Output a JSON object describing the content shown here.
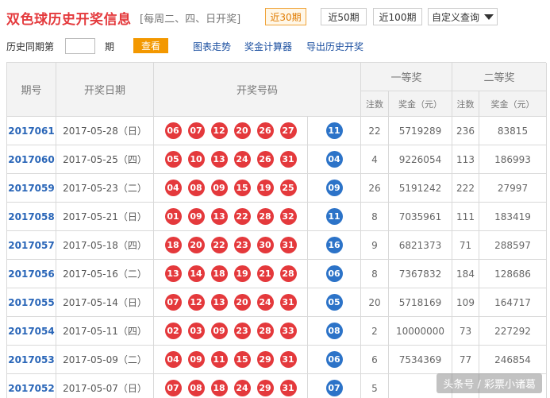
{
  "header": {
    "title": "双色球历史开奖信息",
    "subtitle": "[每周二、四、日开奖]",
    "tabs": [
      {
        "label": "近30期",
        "active": true
      },
      {
        "label": "近50期",
        "active": false
      },
      {
        "label": "近100期",
        "active": false
      }
    ],
    "custom_query": "自定义查询"
  },
  "toolbar": {
    "history_label": "历史同期第",
    "period_value": "",
    "period_unit": "期",
    "view_button": "查看",
    "links": [
      "图表走势",
      "奖金计算器",
      "导出历史开奖"
    ]
  },
  "table": {
    "headers": {
      "issue": "期号",
      "date": "开奖日期",
      "numbers": "开奖号码",
      "first_prize": "一等奖",
      "second_prize": "二等奖",
      "count": "注数",
      "amount": "奖金（元）"
    },
    "rows": [
      {
        "issue": "2017061",
        "date": "2017-05-28（日）",
        "reds": [
          "06",
          "07",
          "12",
          "20",
          "26",
          "27"
        ],
        "blue": "11",
        "first_count": "22",
        "first_amount": "5719289",
        "second_count": "236",
        "second_amount": "83815"
      },
      {
        "issue": "2017060",
        "date": "2017-05-25（四）",
        "reds": [
          "05",
          "10",
          "13",
          "24",
          "26",
          "31"
        ],
        "blue": "04",
        "first_count": "4",
        "first_amount": "9226054",
        "second_count": "113",
        "second_amount": "186993"
      },
      {
        "issue": "2017059",
        "date": "2017-05-23（二）",
        "reds": [
          "04",
          "08",
          "09",
          "15",
          "19",
          "25"
        ],
        "blue": "09",
        "first_count": "26",
        "first_amount": "5191242",
        "second_count": "222",
        "second_amount": "27997"
      },
      {
        "issue": "2017058",
        "date": "2017-05-21（日）",
        "reds": [
          "01",
          "09",
          "13",
          "22",
          "28",
          "32"
        ],
        "blue": "11",
        "first_count": "8",
        "first_amount": "7035961",
        "second_count": "111",
        "second_amount": "183419"
      },
      {
        "issue": "2017057",
        "date": "2017-05-18（四）",
        "reds": [
          "18",
          "20",
          "22",
          "23",
          "30",
          "31"
        ],
        "blue": "16",
        "first_count": "9",
        "first_amount": "6821373",
        "second_count": "71",
        "second_amount": "288597"
      },
      {
        "issue": "2017056",
        "date": "2017-05-16（二）",
        "reds": [
          "13",
          "14",
          "18",
          "19",
          "21",
          "28"
        ],
        "blue": "06",
        "first_count": "8",
        "first_amount": "7367832",
        "second_count": "184",
        "second_amount": "128686"
      },
      {
        "issue": "2017055",
        "date": "2017-05-14（日）",
        "reds": [
          "07",
          "12",
          "13",
          "20",
          "24",
          "31"
        ],
        "blue": "05",
        "first_count": "20",
        "first_amount": "5718169",
        "second_count": "109",
        "second_amount": "164717"
      },
      {
        "issue": "2017054",
        "date": "2017-05-11（四）",
        "reds": [
          "02",
          "03",
          "09",
          "23",
          "28",
          "33"
        ],
        "blue": "08",
        "first_count": "2",
        "first_amount": "10000000",
        "second_count": "73",
        "second_amount": "227292"
      },
      {
        "issue": "2017053",
        "date": "2017-05-09（二）",
        "reds": [
          "04",
          "09",
          "11",
          "15",
          "29",
          "31"
        ],
        "blue": "06",
        "first_count": "6",
        "first_amount": "7534369",
        "second_count": "77",
        "second_amount": "246854"
      },
      {
        "issue": "2017052",
        "date": "2017-05-07（日）",
        "reds": [
          "07",
          "08",
          "18",
          "24",
          "29",
          "31"
        ],
        "blue": "07",
        "first_count": "5",
        "first_amount": "",
        "second_count": "",
        "second_amount": ""
      }
    ]
  },
  "watermark": "头条号 / 彩票小诸葛",
  "colors": {
    "title_red": "#e4393c",
    "red_ball": "#e4393c",
    "blue_ball": "#2c73c8",
    "issue_blue": "#2a66b8",
    "active_tab": "#f0a43a",
    "view_button": "#f39800",
    "link_blue": "#1b4fa0"
  }
}
